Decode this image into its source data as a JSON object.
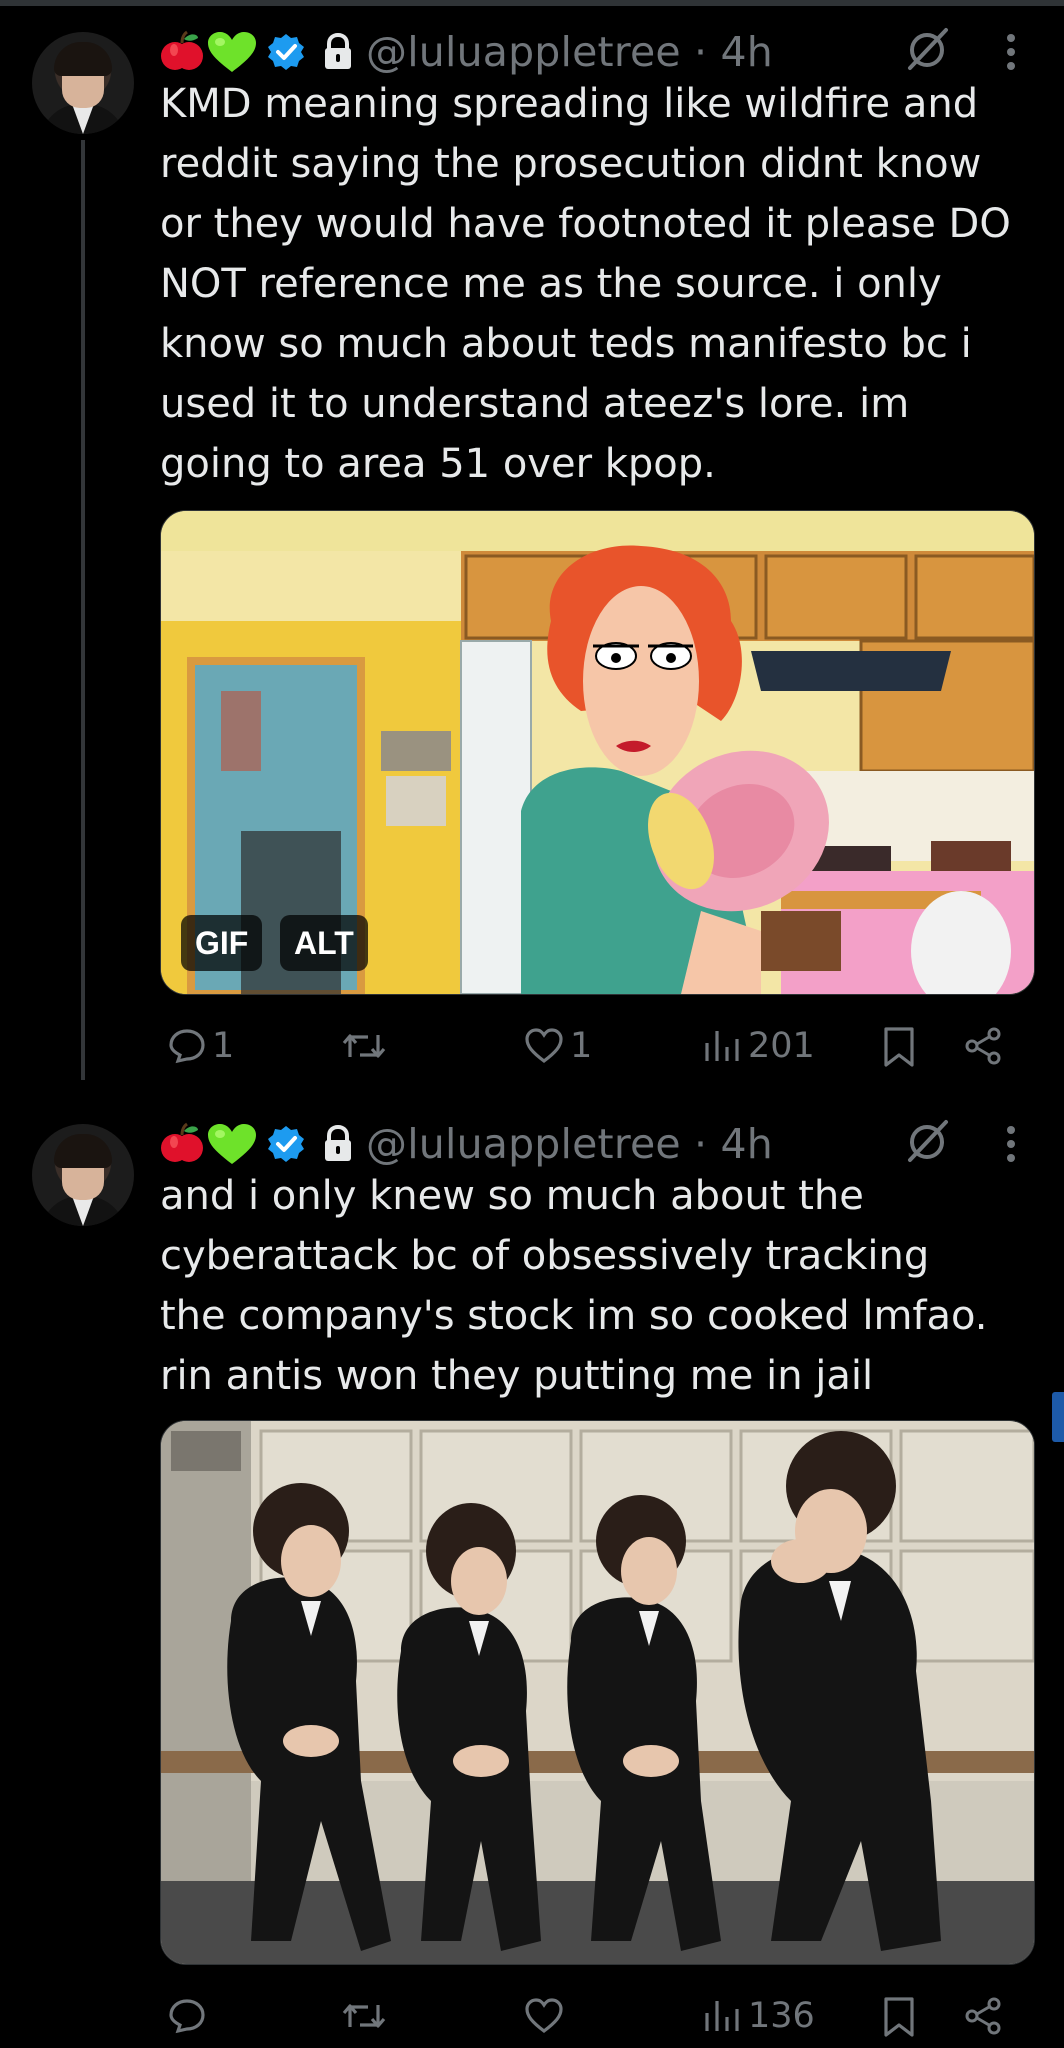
{
  "tweets": [
    {
      "handle": "@luluappletree · 4h",
      "text": "KMD meaning spreading like wildfire and\nreddit saying the prosecution didnt know\nor they would have footnoted it please DO\nNOT reference me as the source. i only\nknow so much about teds manifesto bc i\nused it to understand ateez's lore. im\ngoing to area 51 over kpop.",
      "media": {
        "badges": [
          "GIF",
          "ALT"
        ]
      },
      "actions": {
        "reply_count": "1",
        "retweet_count": "",
        "like_count": "1",
        "view_count": "201"
      }
    },
    {
      "handle": "@luluappletree · 4h",
      "text": "and i only knew so much about the\ncyberattack bc of obsessively tracking\nthe company's stock im so cooked lmfao.\nrin antis won they putting me in jail",
      "actions": {
        "reply_count": "",
        "retweet_count": "",
        "like_count": "",
        "view_count": "136"
      }
    }
  ],
  "colors": {
    "background": "#000000",
    "text": "#e7e9ea",
    "muted": "#71767b",
    "verified": "#1d9bf0"
  },
  "icons": [
    "apple-emoji",
    "green-heart-emoji",
    "verified-badge-icon",
    "lock-icon",
    "grok-icon",
    "more-icon",
    "reply-icon",
    "retweet-icon",
    "like-icon",
    "views-icon",
    "bookmark-icon",
    "share-icon"
  ]
}
